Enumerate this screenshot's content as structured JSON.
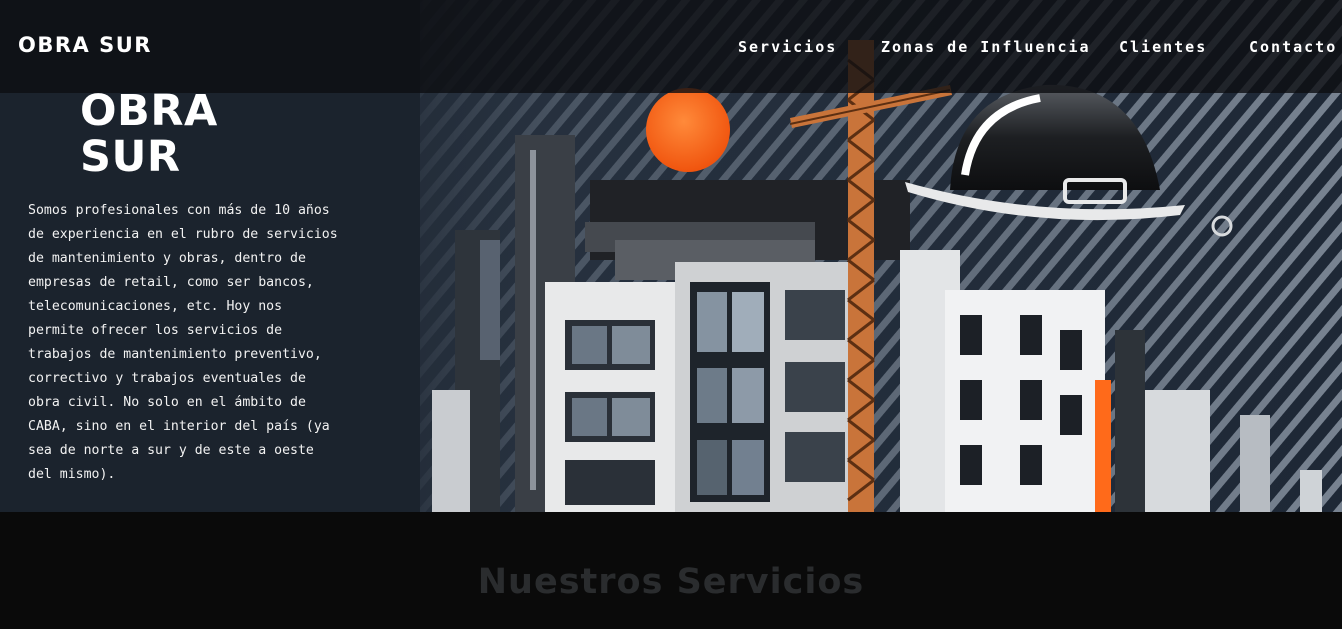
{
  "header": {
    "brand": "OBRA SUR",
    "nav": [
      {
        "label": "Servicios"
      },
      {
        "label": "Zonas de Influencia"
      },
      {
        "label": "Clientes"
      },
      {
        "label": "Contacto"
      }
    ]
  },
  "hero": {
    "title_line1": "OBRA",
    "title_line2": "SUR",
    "description": "Somos profesionales con más de 10 años de experiencia en el rubro de servicios de mantenimiento y obras, dentro de empresas de retail, como ser bancos, telecomunicaciones, etc. Hoy nos permite ofrecer los servicios de trabajos de mantenimiento preventivo, correctivo y trabajos eventuales de obra civil. No solo en el ámbito de CABA, sino en el interior del país (ya sea de norte a sur y de este a oeste del mismo)."
  },
  "services": {
    "title": "Nuestros Servicios"
  },
  "colors": {
    "accent_orange": "#ff6a1a",
    "crane": "#c9743a",
    "section_bg": "#0a0a0a"
  }
}
